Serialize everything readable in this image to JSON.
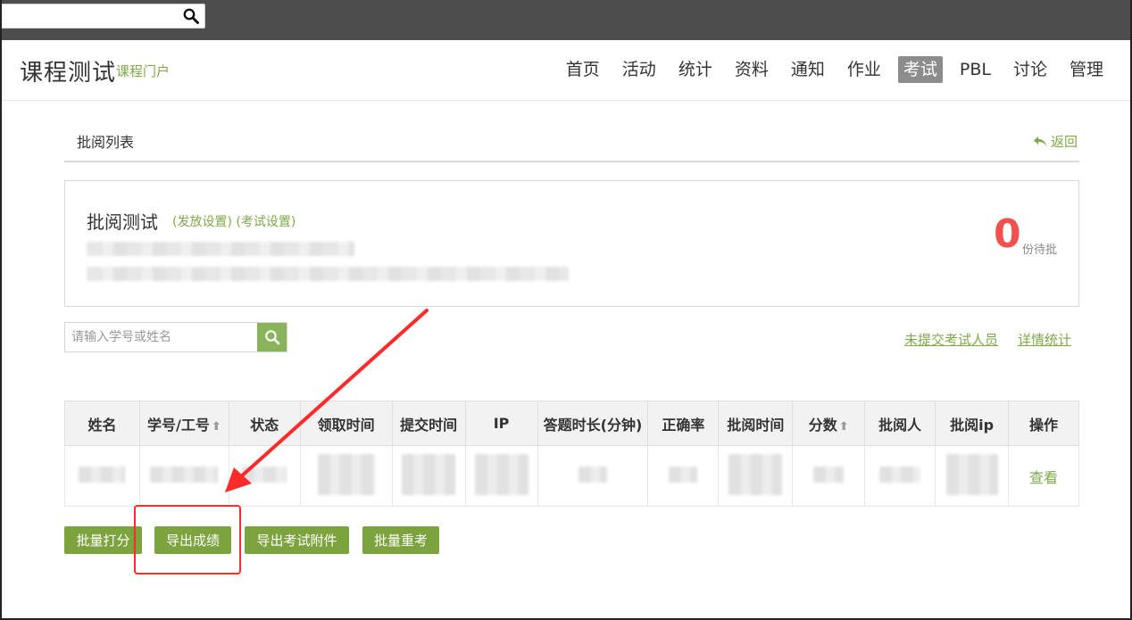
{
  "header": {
    "course_title": "课程测试",
    "portal_link": "课程门户",
    "nav": [
      {
        "label": "首页",
        "active": false
      },
      {
        "label": "活动",
        "active": false
      },
      {
        "label": "统计",
        "active": false
      },
      {
        "label": "资料",
        "active": false
      },
      {
        "label": "通知",
        "active": false
      },
      {
        "label": "作业",
        "active": false
      },
      {
        "label": "考试",
        "active": true
      },
      {
        "label": "PBL",
        "active": false
      },
      {
        "label": "讨论",
        "active": false
      },
      {
        "label": "管理",
        "active": false
      }
    ]
  },
  "page": {
    "heading": "批阅列表",
    "back_label": "返回"
  },
  "summary": {
    "exam_title": "批阅测试",
    "release_settings": "(发放设置)",
    "exam_settings": "(考试设置)",
    "pending_count": "0",
    "pending_label": "份待批"
  },
  "search": {
    "placeholder": "请输入学号或姓名"
  },
  "links": {
    "not_submitted": "未提交考试人员",
    "detail_stats": "详情统计"
  },
  "table": {
    "headers": [
      "姓名",
      "学号/工号",
      "状态",
      "领取时间",
      "提交时间",
      "IP",
      "答题时长(分钟)",
      "正确率",
      "批阅时间",
      "分数",
      "批阅人",
      "批阅ip",
      "操作"
    ],
    "row_action": "查看"
  },
  "buttons": {
    "batch_score": "批量打分",
    "export_grades": "导出成绩",
    "export_attachments": "导出考试附件",
    "batch_retake": "批量重考"
  },
  "colors": {
    "accent_green": "#7da33e",
    "link_green": "#7fa84a",
    "pending_red": "#f0514f",
    "annotation_red": "#ff2a2a"
  }
}
